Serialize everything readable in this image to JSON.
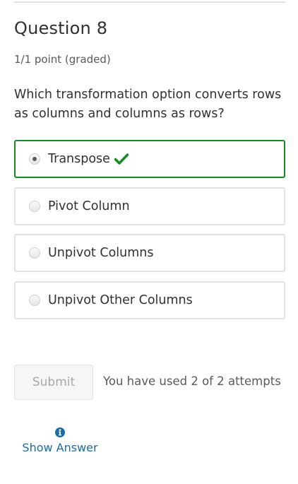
{
  "question": {
    "title": "Question 8",
    "score": "1/1 point (graded)",
    "prompt": "Which transformation option converts rows as columns and columns as rows?"
  },
  "options": [
    {
      "label": "Transpose",
      "selected": true,
      "correct": true
    },
    {
      "label": "Pivot Column",
      "selected": false
    },
    {
      "label": "Unpivot Columns",
      "selected": false
    },
    {
      "label": "Unpivot Other Columns",
      "selected": false
    }
  ],
  "actions": {
    "submit_label": "Submit",
    "attempts_text": "You have used 2 of 2 attempts",
    "show_answer_label": "Show Answer"
  },
  "icons": {
    "correct": "checkmark-icon",
    "info": "info-icon"
  },
  "colors": {
    "correct": "#178c22",
    "link": "#1a6ea6"
  }
}
